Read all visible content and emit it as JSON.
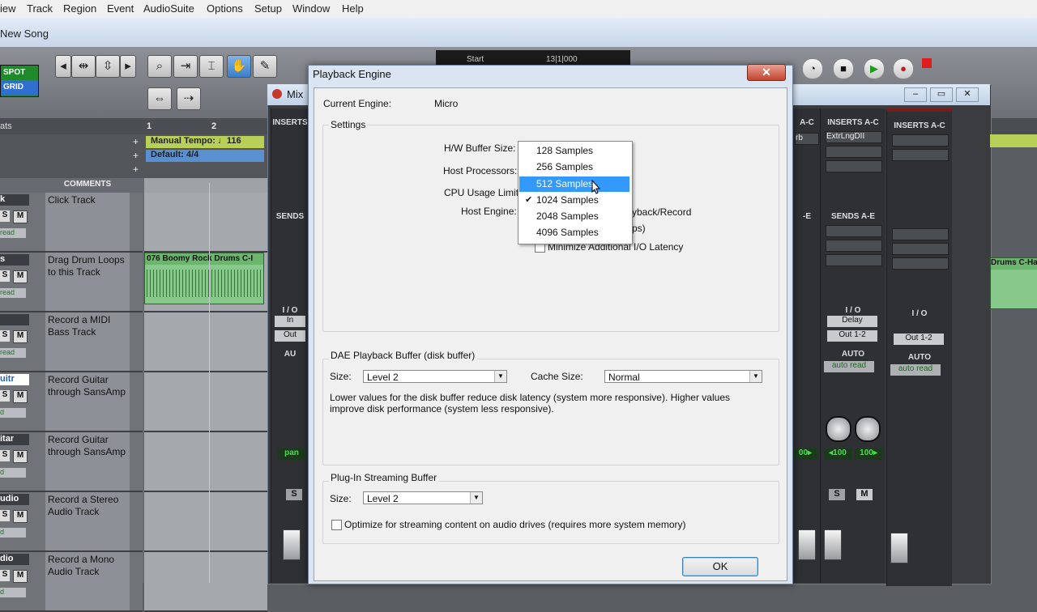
{
  "menubar": {
    "items": [
      "iew",
      "Track",
      "Region",
      "Event",
      "AudioSuite",
      "Options",
      "Setup",
      "Window",
      "Help"
    ]
  },
  "edit_window": {
    "title": "New Song"
  },
  "toolbar": {
    "spot": "SPOT",
    "grid": "GRID",
    "counter_label": "Start",
    "counter_value": "13|1|000"
  },
  "ruler": {
    "label": "ats",
    "bar1": "1",
    "bar2": "2",
    "tempo": "Manual Tempo:",
    "tempo_value": "♩116",
    "meter": "Default: 4/4"
  },
  "tracklist": {
    "comments_header": "COMMENTS",
    "tracks": [
      {
        "name": "k",
        "comment": "Click Track",
        "mode": "read"
      },
      {
        "name": "s",
        "comment": "Drag Drum Loops to this Track",
        "mode": "read"
      },
      {
        "name": "",
        "comment": "Record a MIDI Bass Track",
        "mode": "read"
      },
      {
        "name": "uitr",
        "comment": "Record  Guitar through SansAmp",
        "mode": "d"
      },
      {
        "name": "itar",
        "comment": "Record Guitar through SansAmp",
        "mode": "d"
      },
      {
        "name": "udio",
        "comment": "Record a Stereo Audio Track",
        "mode": "d"
      },
      {
        "name": "dio",
        "comment": "Record a Mono Audio Track",
        "mode": "d"
      }
    ]
  },
  "region": {
    "name": "076 Boomy Rock Drums C-I"
  },
  "mixer": {
    "title": "Mix",
    "strips": [
      {
        "inserts": "INSERTS A-C",
        "insert1": "ExtrLngDII",
        "sends": "SENDS A-E",
        "io_label": "I / O",
        "io_in": "Delay",
        "io_out": "Out 1-2",
        "auto_label": "AUTO",
        "auto": "auto read",
        "pan_l": "◂100",
        "pan_r": "100▸",
        "solo": "S",
        "mute": "M"
      },
      {
        "inserts": "INSERTS A-C",
        "insert1": "",
        "sends": "",
        "io_label": "I / O",
        "io_in": "",
        "io_out": "Out 1-2",
        "auto_label": "AUTO",
        "auto": "auto read",
        "pan_l": "",
        "pan_r": "",
        "solo": "",
        "mute": ""
      }
    ],
    "side_labels": {
      "inserts": "INSERTS",
      "sends": "SENDS",
      "io": "I / O",
      "in": "In",
      "out": "Out",
      "auto": "AU",
      "pan": "pan",
      "s": "S",
      "rb": "rb",
      "ac": "A-C",
      "ae": "-E",
      "o100": "00▸",
      "rdrums": "Drums C-Ha"
    }
  },
  "dialog": {
    "title": "Playback Engine",
    "close": "✕",
    "current_engine_label": "Current Engine:",
    "current_engine_value": "Micro",
    "settings_label": "Settings",
    "hw_buffer_label": "H/W Buffer Size:",
    "host_processors_label": "Host Processors:",
    "cpu_usage_label": "CPU Usage Limit:",
    "host_engine_label": "Host Engine:",
    "playback_record_text": "yback/Record",
    "ps_text": "ps)",
    "minimize_label": "Minimize Additional I/O Latency",
    "dae_group": "DAE Playback Buffer (disk buffer)",
    "size_label": "Size:",
    "size_value": "Level 2",
    "cache_label": "Cache Size:",
    "cache_value": "Normal",
    "dae_help": "Lower values for the disk buffer reduce disk latency (system more responsive).  Higher values improve disk performance (system less responsive).",
    "plugin_group": "Plug-In Streaming Buffer",
    "plugin_size_label": "Size:",
    "plugin_size_value": "Level 2",
    "optimize_label": "Optimize for streaming content on audio drives (requires more system memory)",
    "ok": "OK"
  },
  "hw_buffer_dropdown": {
    "options": [
      "128 Samples",
      "256 Samples",
      "512 Samples",
      "1024 Samples",
      "2048 Samples",
      "4096 Samples"
    ],
    "highlighted": "512 Samples",
    "checked": "1024 Samples"
  }
}
